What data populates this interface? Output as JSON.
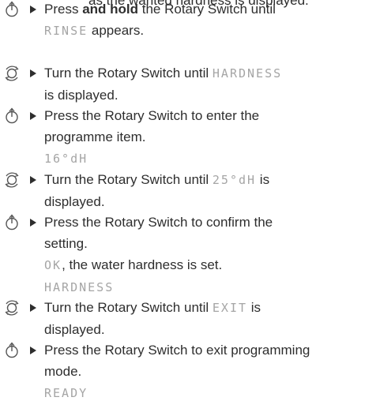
{
  "header_partial": "as the wanted hardness is displayed.",
  "steps": [
    {
      "icon": "press-rotary-switch-icon",
      "pre": "Press ",
      "bold": "and hold",
      "post": " the Rotary Switch until",
      "display": "RINSE",
      "after": " appears."
    },
    {
      "icon": "turn-rotary-switch-icon",
      "pre": "Turn the Rotary Switch until ",
      "display": "HARDNESS",
      "line2": "is displayed."
    },
    {
      "icon": "press-rotary-switch-icon",
      "line1": "Press the Rotary Switch to enter the",
      "line2": "programme item.",
      "display": "16°dH"
    },
    {
      "icon": "turn-rotary-switch-icon",
      "pre": "Turn the Rotary Switch until ",
      "display": "25°dH",
      "post": " is",
      "line2": "displayed."
    },
    {
      "icon": "press-rotary-switch-icon",
      "line1": "Press the Rotary Switch to confirm the",
      "line2": "setting.",
      "display_ok": "OK",
      "after_ok": ", the water hardness is set.",
      "display": "HARDNESS"
    },
    {
      "icon": "turn-rotary-switch-icon",
      "pre": "Turn the Rotary Switch until ",
      "display": "EXIT",
      "post": " is",
      "line2": "displayed."
    },
    {
      "icon": "press-rotary-switch-icon",
      "line1": "Press the Rotary Switch to exit programming",
      "line2": "mode.",
      "display": "READY"
    }
  ]
}
